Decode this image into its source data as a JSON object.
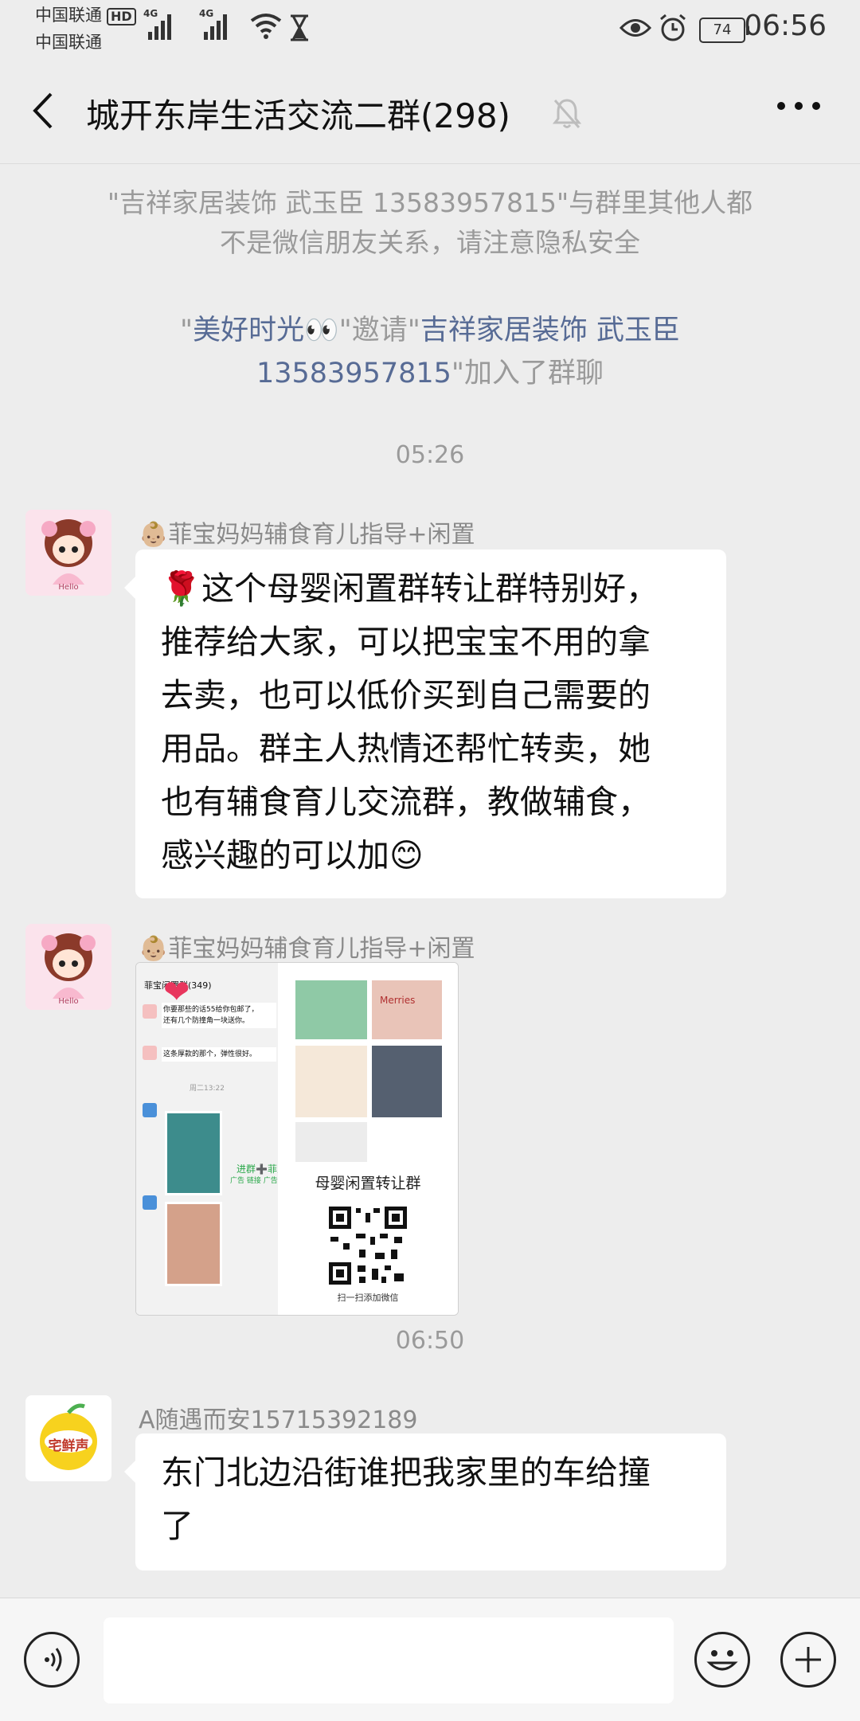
{
  "status_bar": {
    "carrier1": "中国联通",
    "carrier2": "中国联通",
    "hd": "HD",
    "net1": "4G",
    "net2": "4G",
    "battery": "74",
    "time": "06:56"
  },
  "header": {
    "title": "城开东岸生活交流二群(298)",
    "back_icon": "chevron-left-icon",
    "mute_icon": "bell-off-icon",
    "more_icon": "more-dots-icon"
  },
  "messages": {
    "sys1_a": "\"吉祥家居装饰 武玉臣 13583957815\"与群里其他人都",
    "sys1_b": "不是微信朋友关系，请注意隐私安全",
    "sys2": {
      "q1": "\"",
      "inviter": "美好时光👀",
      "mid": "\"邀请\"",
      "invitee1": "吉祥家居装饰 武玉臣",
      "invitee2": "13583957815",
      "end": "\"加入了群聊"
    },
    "time1": "05:26",
    "msg1": {
      "sender": "👶🏼菲宝妈妈辅食育儿指导+闲置",
      "lines": [
        "🌹这个母婴闲置群转让群特别好，",
        "推荐给大家，可以把宝宝不用的拿",
        "去卖，也可以低价买到自己需要的",
        "用品。群主人热情还帮忙转卖，她",
        "也有辅食育儿交流群，教做辅食，",
        "感兴趣的可以加😊"
      ]
    },
    "msg2": {
      "sender": "👶🏼菲宝妈妈辅食育儿指导+闲置",
      "image": {
        "group_title": "菲宝闲置群(349)",
        "chat1": "你要那些的话55给你包邮了，",
        "chat1b": "还有几个防撞角一块送你。",
        "chat2": "这条厚款的那个，弹性很好。",
        "time_label": "周二13:22",
        "promo": "进群➕菲宝妈妈",
        "promo2": "广告 链接 广告党请绕行",
        "poster_title": "母婴闲置转让群",
        "poster_brand": "Merries",
        "poster_caption": "扫一扫添加微信"
      }
    },
    "time2": "06:50",
    "msg3": {
      "sender": "A随遇而安15715392189",
      "avatar_text": "宅鲜声",
      "lines": [
        "东门北边沿街谁把我家里的车给撞",
        "了"
      ]
    },
    "avatar1_text": "Hello"
  },
  "input_bar": {
    "voice_icon": "voice-icon",
    "emoji_icon": "emoji-icon",
    "plus_icon": "plus-icon",
    "placeholder": ""
  }
}
